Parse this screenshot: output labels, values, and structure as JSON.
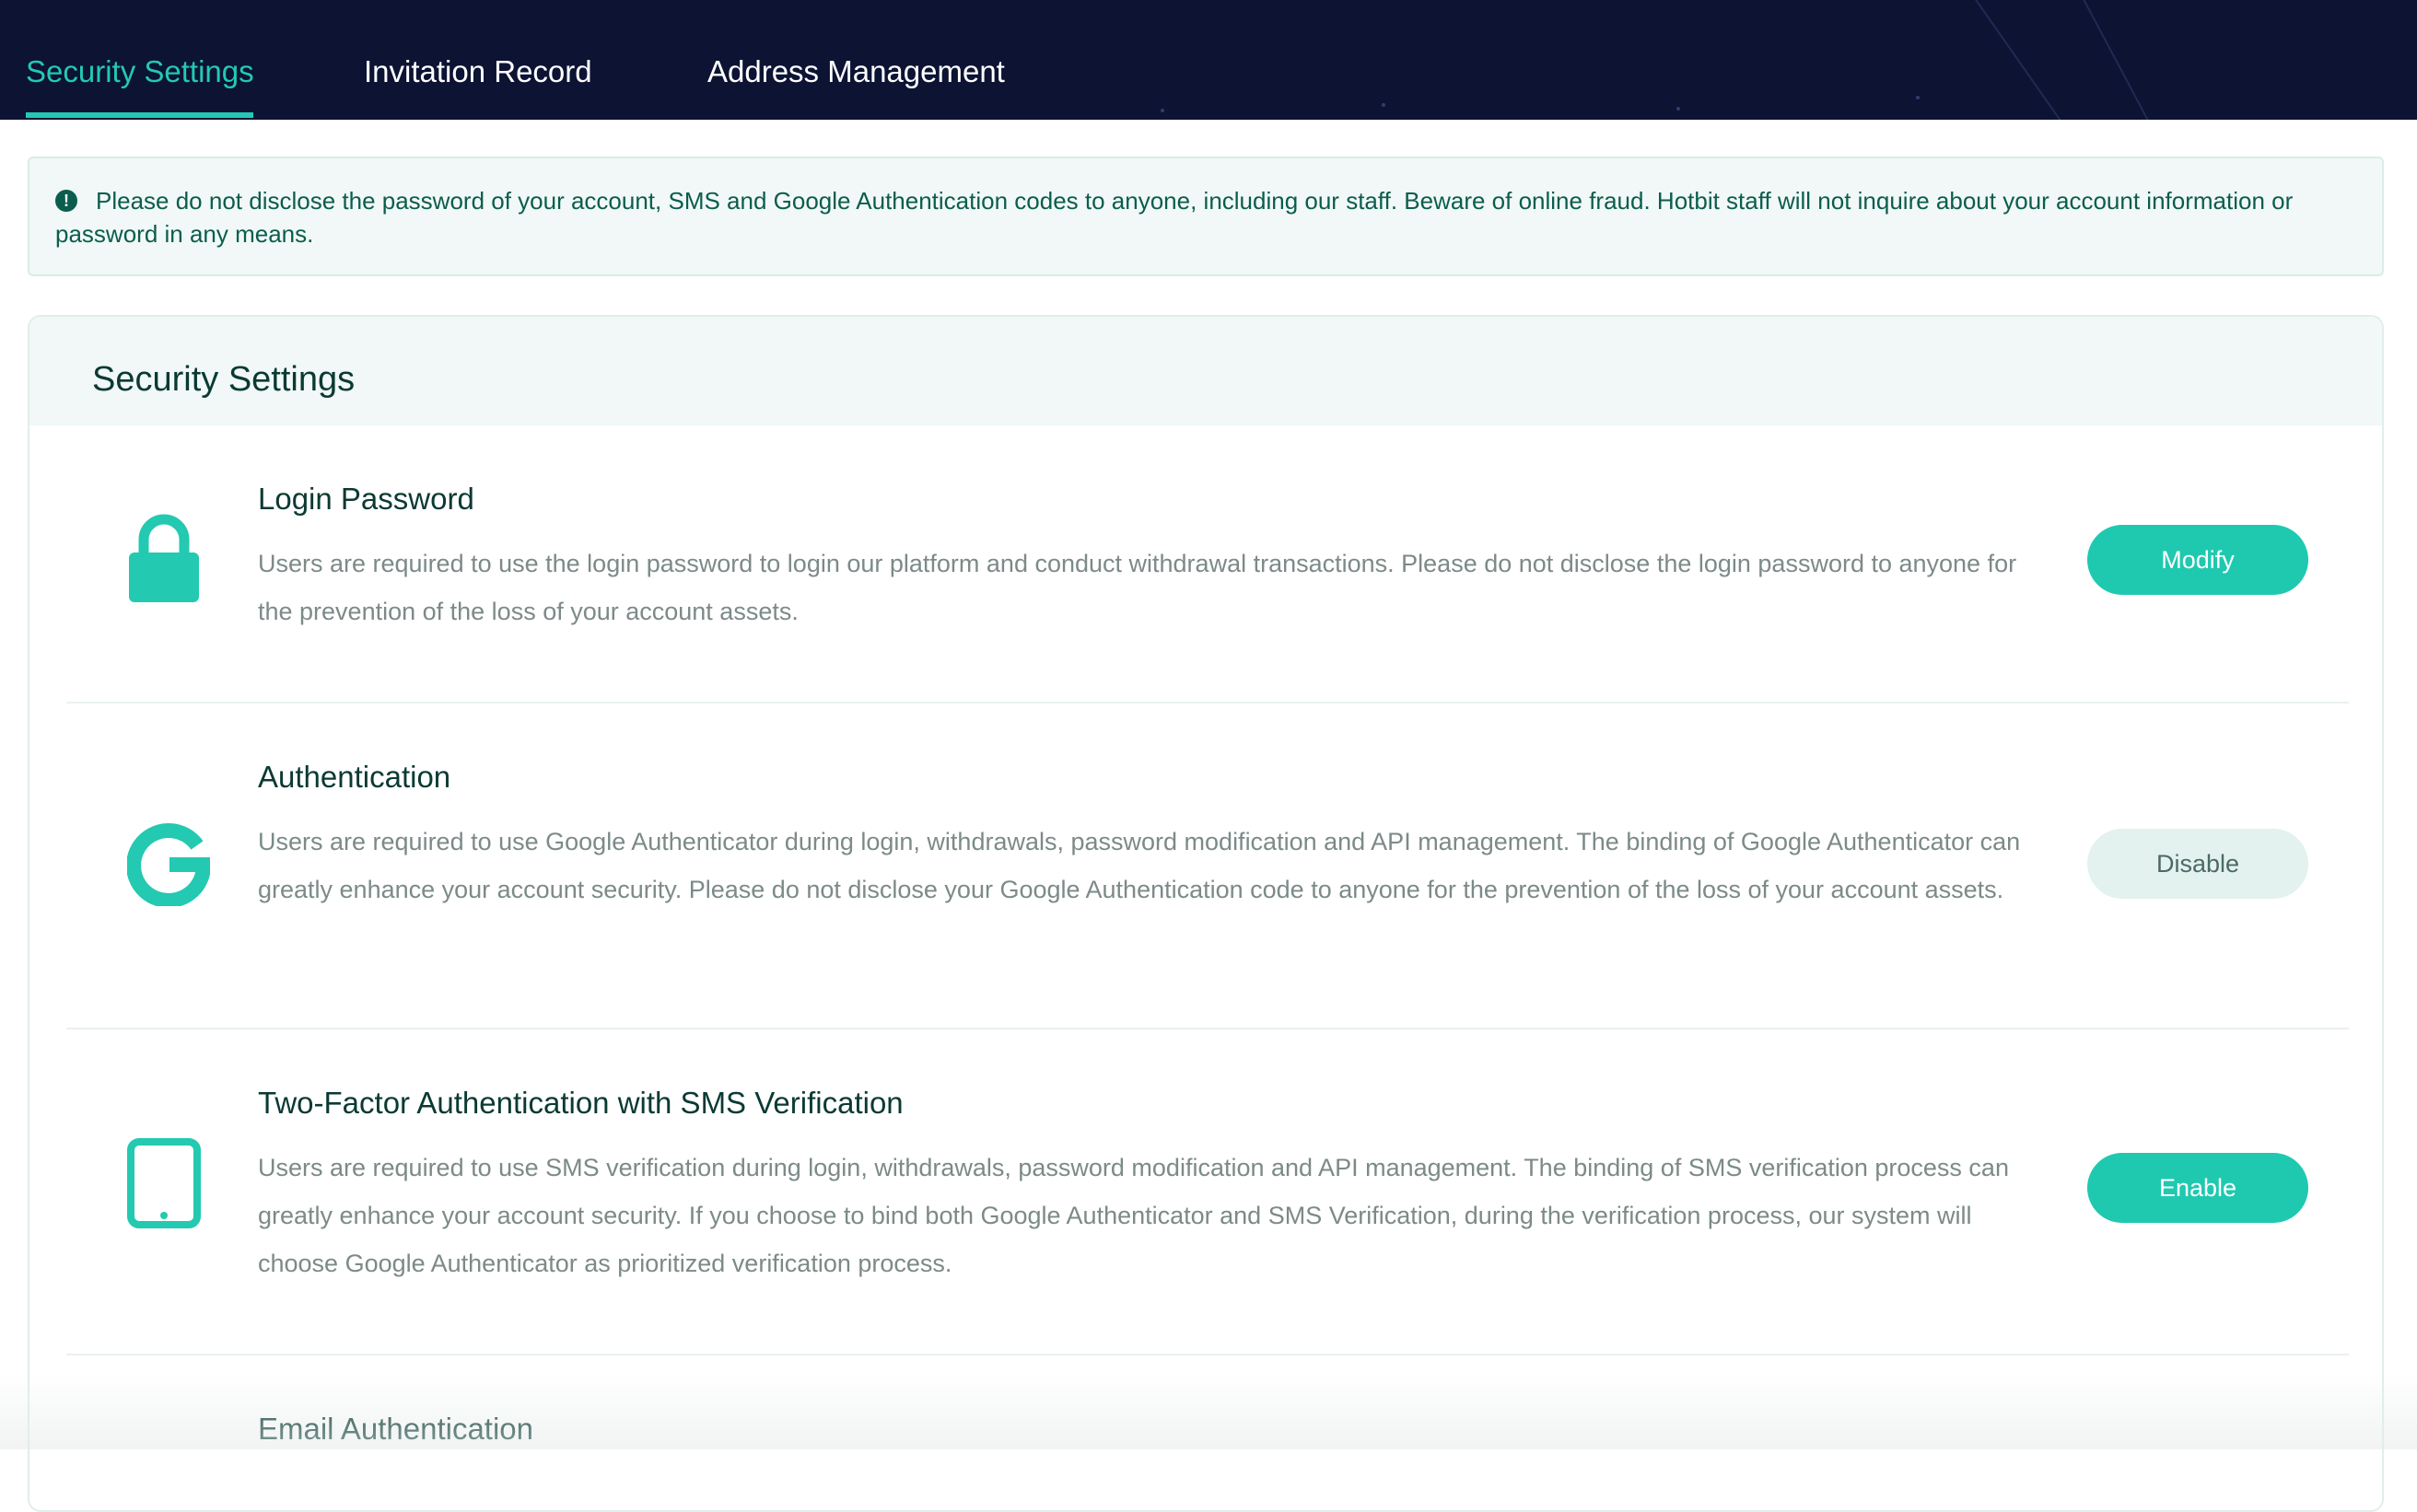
{
  "tabs": [
    {
      "label": "Security Settings",
      "active": true
    },
    {
      "label": "Invitation Record",
      "active": false
    },
    {
      "label": "Address Management",
      "active": false
    }
  ],
  "notice": {
    "icon": "exclamation-circle-icon",
    "text": "Please do not disclose the password of your account, SMS and Google Authentication codes to anyone, including our staff. Beware of online fraud. Hotbit staff will not inquire about your account information or password in any means."
  },
  "security": {
    "title": "Security Settings",
    "items": [
      {
        "icon": "lock-icon",
        "title": "Login Password",
        "description": "Users are required to use the login password to login our platform and conduct withdrawal transactions. Please do not disclose the login password to anyone for the prevention of the loss of your account assets.",
        "button": "Modify",
        "button_style": "primary"
      },
      {
        "icon": "google-g-icon",
        "title": "Authentication",
        "description": "Users are required to use Google Authenticator during login, withdrawals, password modification and API management. The binding of Google Authenticator can greatly enhance your account security. Please do not disclose your Google Authentication code to anyone for the prevention of the loss of your account assets.",
        "button": "Disable",
        "button_style": "muted"
      },
      {
        "icon": "tablet-icon",
        "title": "Two-Factor Authentication with SMS Verification",
        "description": "Users are required to use SMS verification during login, withdrawals, password modification and API management. The binding of SMS verification process can greatly enhance your account security. If you choose to bind both Google Authenticator and SMS Verification, during the verification process, our system will choose Google Authenticator as prioritized verification process.",
        "button": "Enable",
        "button_style": "primary"
      },
      {
        "title": "Email Authentication"
      }
    ]
  },
  "colors": {
    "topbar_bg": "#0c1333",
    "accent": "#23c9b1",
    "notice_text": "#0b5d4d",
    "muted_button_bg": "#e3f1ef"
  }
}
